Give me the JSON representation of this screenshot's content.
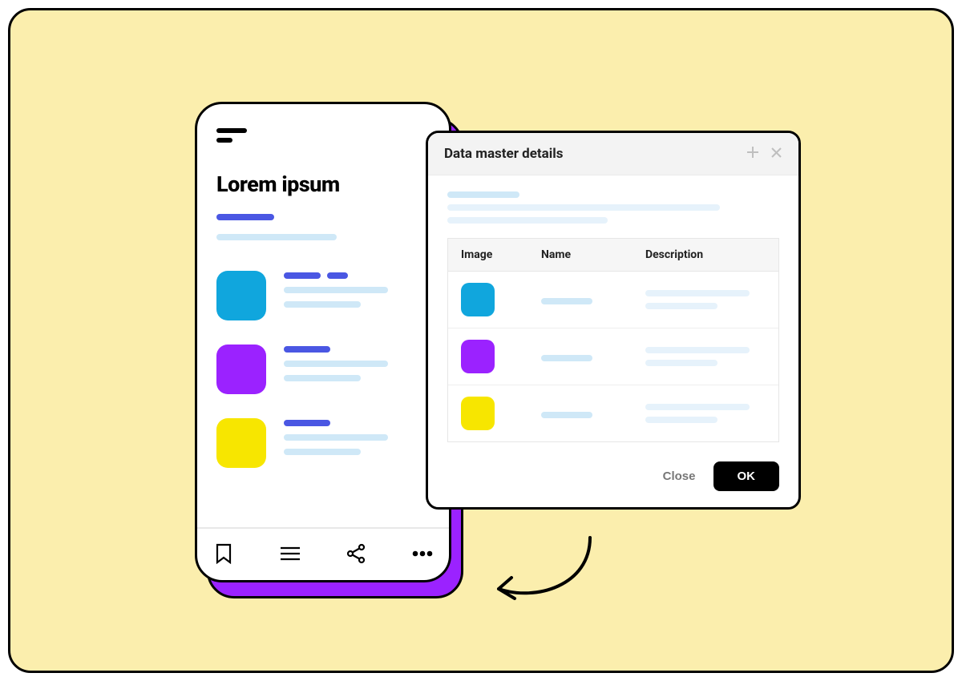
{
  "phone": {
    "title": "Lorem ipsum",
    "items": [
      {
        "color": "cyan"
      },
      {
        "color": "purple"
      },
      {
        "color": "yellow"
      }
    ]
  },
  "dialog": {
    "title": "Data master details",
    "columns": {
      "image": "Image",
      "name": "Name",
      "description": "Description"
    },
    "rows": [
      {
        "color": "cyan"
      },
      {
        "color": "purple"
      },
      {
        "color": "yellow"
      }
    ],
    "close_label": "Close",
    "ok_label": "OK"
  }
}
